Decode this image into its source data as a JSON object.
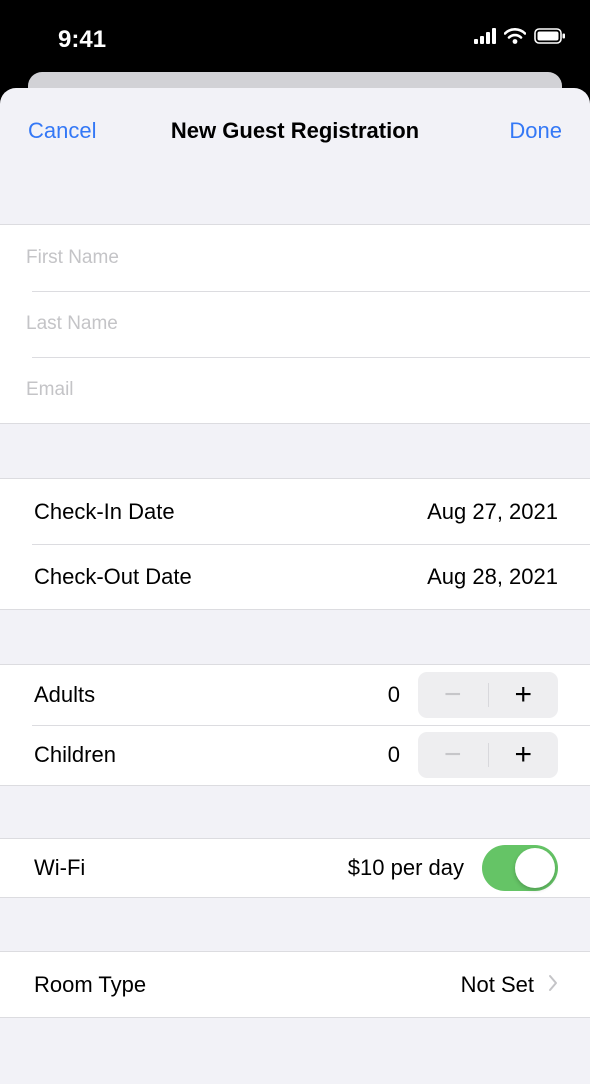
{
  "status_bar": {
    "time": "9:41"
  },
  "nav": {
    "cancel": "Cancel",
    "title": "New Guest Registration",
    "done": "Done"
  },
  "guest": {
    "first_name_placeholder": "First Name",
    "last_name_placeholder": "Last Name",
    "email_placeholder": "Email"
  },
  "dates": {
    "check_in_label": "Check-In Date",
    "check_in_value": "Aug 27, 2021",
    "check_out_label": "Check-Out Date",
    "check_out_value": "Aug 28, 2021"
  },
  "occupants": {
    "adults_label": "Adults",
    "adults_count": "0",
    "children_label": "Children",
    "children_count": "0",
    "minus_symbol": "−",
    "plus_symbol": "+"
  },
  "wifi": {
    "label": "Wi-Fi",
    "price": "$10 per day",
    "enabled": true
  },
  "room": {
    "label": "Room Type",
    "value": "Not Set"
  },
  "colors": {
    "accent": "#3478f6",
    "switch_on": "#65c466",
    "background": "#f2f2f7"
  }
}
